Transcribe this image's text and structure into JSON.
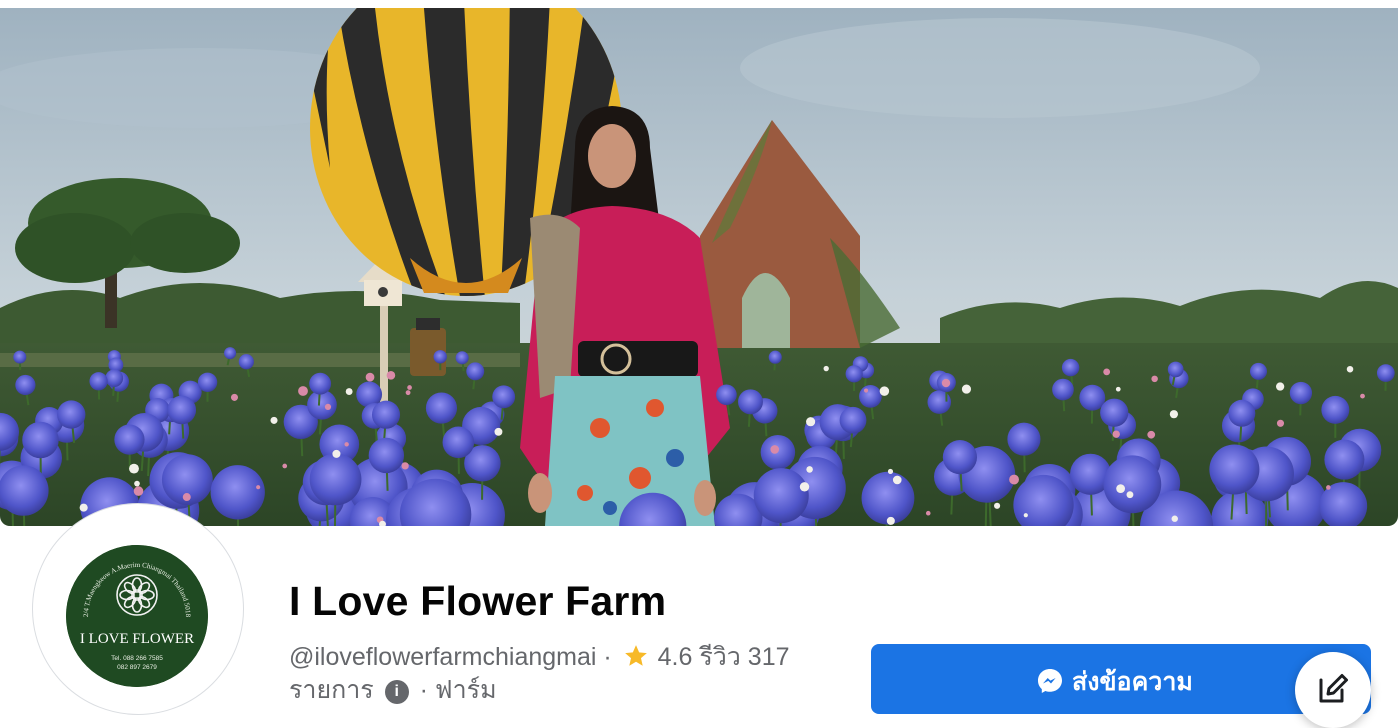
{
  "page": {
    "name": "I Love Flower Farm",
    "handle": "@iloveflowerfarmchiangmai",
    "separator": "·",
    "rating": "4.6",
    "reviews_label": "รีวิว 317",
    "listing_label": "รายการ",
    "info_symbol": "i",
    "category": "ฟาร์ม",
    "star_color": "#f7b928"
  },
  "logo": {
    "arc_text": "32/4 T.Maengkeow A.Maerim Chiangmai Thailand 50180",
    "brand_text": "I LOVE FLOWER",
    "phone_1": "Tel. 088 266 7585",
    "phone_2": "082 897 2679",
    "bg_color": "#1f4a22"
  },
  "actions": {
    "message_label": "ส่งข้อความ",
    "message_icon": "messenger-icon",
    "compose_icon": "compose-icon",
    "accent_color": "#1b74e4"
  }
}
